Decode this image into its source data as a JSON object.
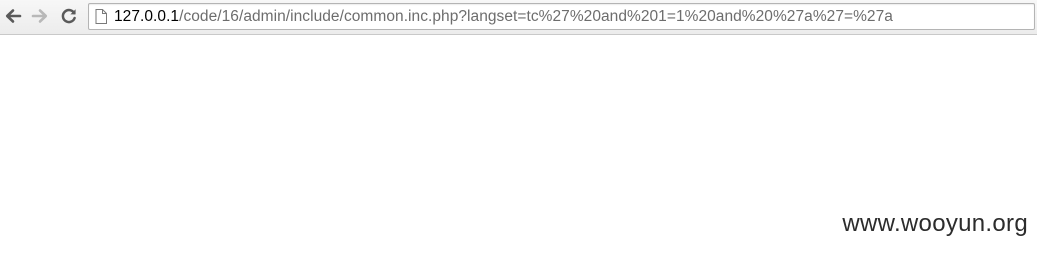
{
  "browser": {
    "toolbar": {
      "back_icon": "arrow-left-icon",
      "forward_icon": "arrow-right-icon",
      "reload_icon": "reload-icon"
    },
    "address_bar": {
      "page_icon": "document-icon",
      "url_host": "127.0.0.1",
      "url_rest": "/code/16/admin/include/common.inc.php?langset=tc%27%20and%201=1%20and%20%27a%27=%27a"
    }
  },
  "page": {
    "watermark": "www.wooyun.org"
  },
  "colors": {
    "host_text": "#000000",
    "path_text": "#6d6d6d",
    "toolbar_bg": "#ececec",
    "icon_active": "#5a5a5a",
    "icon_disabled": "#b8b8b8"
  }
}
